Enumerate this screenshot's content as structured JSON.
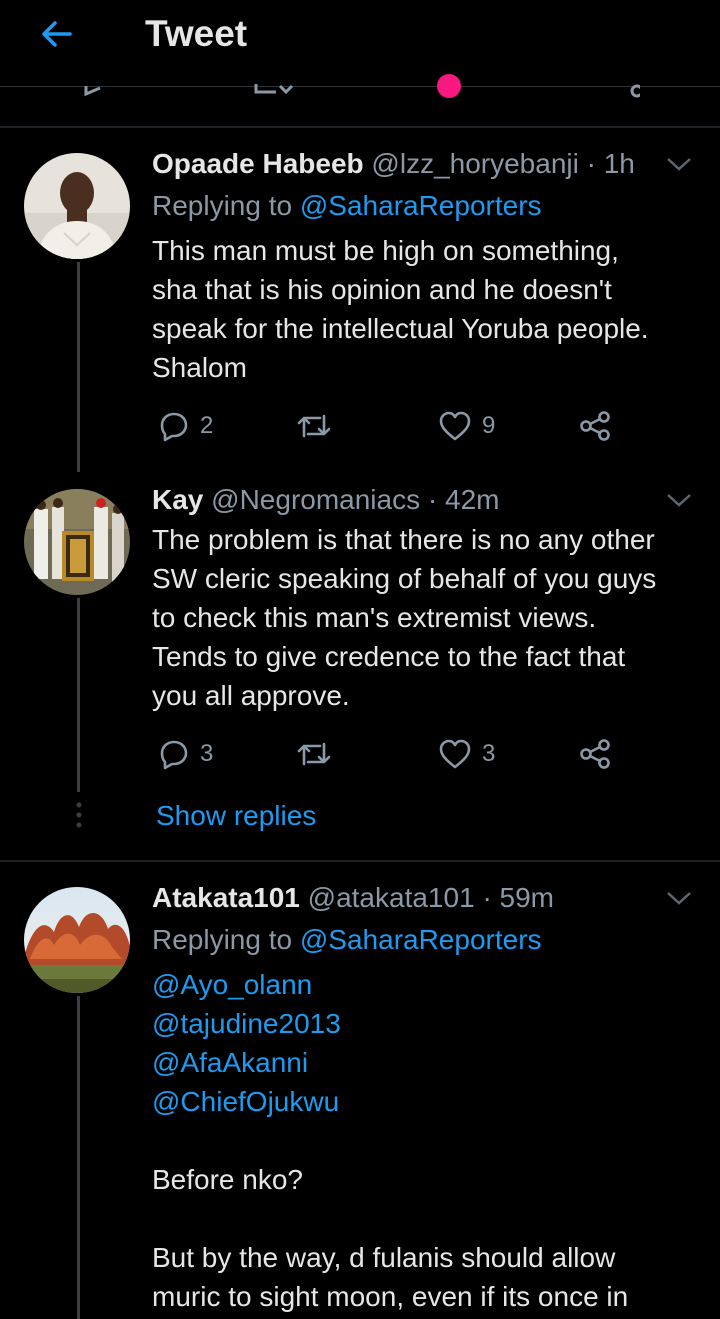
{
  "header": {
    "title": "Tweet",
    "back_icon": "arrow-left-icon"
  },
  "colors": {
    "accent": "#1d9bf0",
    "like": "#f91880",
    "text": "#e6e6e6",
    "muted": "#8b98a5",
    "background": "#000000"
  },
  "tweets": [
    {
      "name": "Opaade Habeeb",
      "handle": "@lzz_horyebanji",
      "time": "· 1h",
      "replying_prefix": "Replying to ",
      "replying_to": "@SaharaReporters",
      "text_lines": [
        "This man must be high on something,",
        "sha that is his opinion and he doesn't",
        "speak for the intellectual Yoruba people.",
        "Shalom"
      ],
      "replies": "2",
      "retweets": "",
      "likes": "9"
    },
    {
      "name": "Kay",
      "handle": "@Negromaniacs",
      "time": "· 42m",
      "text_lines": [
        "The problem is that there is no any other",
        "SW cleric speaking of behalf of you guys",
        "to check this man's extremist views.",
        "Tends to give credence to the fact that",
        "you all approve."
      ],
      "replies": "3",
      "retweets": "",
      "likes": "3"
    },
    {
      "name": "Atakata101",
      "handle": "@atakata101",
      "time": "· 59m",
      "replying_prefix": "Replying to ",
      "replying_to": "@SaharaReporters",
      "mentions": [
        "@Ayo_olann",
        "@tajudine2013",
        "@AfaAkanni",
        "@ChiefOjukwu"
      ],
      "text_lines": [
        "Before nko?",
        "",
        "But by the way, d fulanis should allow",
        "muric to sight moon, even if its once in"
      ]
    }
  ],
  "show_replies": "Show replies",
  "icons": [
    "reply-icon",
    "retweet-icon",
    "like-icon",
    "share-icon",
    "chevron-down-icon",
    "more-dots-icon"
  ]
}
